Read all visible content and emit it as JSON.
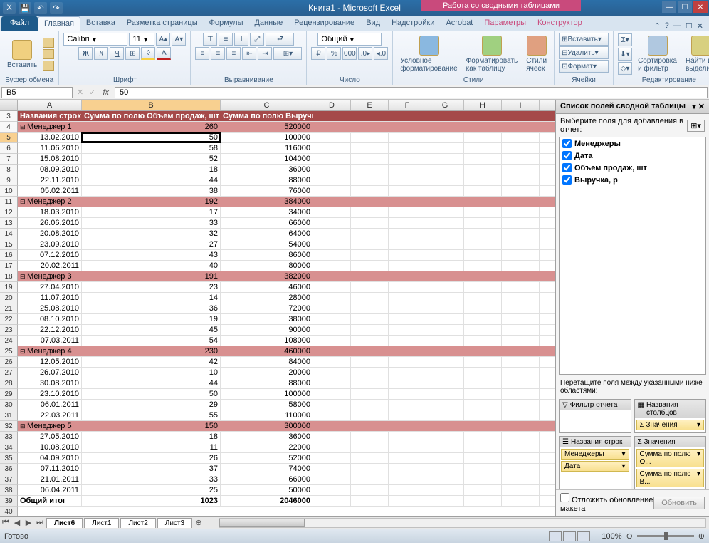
{
  "title": "Книга1 - Microsoft Excel",
  "contextTab": "Работа со сводными таблицами",
  "tabs": {
    "file": "Файл",
    "list": [
      "Главная",
      "Вставка",
      "Разметка страницы",
      "Формулы",
      "Данные",
      "Рецензирование",
      "Вид",
      "Надстройки",
      "Acrobat"
    ],
    "ctx": [
      "Параметры",
      "Конструктор"
    ],
    "active": "Главная"
  },
  "ribbon": {
    "clipboard": {
      "paste": "Вставить",
      "label": "Буфер обмена"
    },
    "font": {
      "name": "Calibri",
      "size": "11",
      "label": "Шрифт"
    },
    "align": {
      "label": "Выравнивание"
    },
    "number": {
      "format": "Общий",
      "label": "Число"
    },
    "styles": {
      "cond": "Условное форматирование",
      "table": "Форматировать как таблицу",
      "cell": "Стили ячеек",
      "label": "Стили"
    },
    "cells": {
      "insert": "Вставить",
      "delete": "Удалить",
      "format": "Формат",
      "label": "Ячейки"
    },
    "editing": {
      "sort": "Сортировка и фильтр",
      "find": "Найти и выделить",
      "label": "Редактирование"
    }
  },
  "namebox": "B5",
  "formula": "50",
  "cols": [
    "A",
    "B",
    "C",
    "D",
    "E",
    "F",
    "G",
    "H",
    "I"
  ],
  "colWidths": {
    "A": 90,
    "B": 195,
    "C": 130
  },
  "pivotHeader": [
    "Названия строк",
    "Сумма по полю Объем продаж, шт",
    "Сумма по полю Выручка, р"
  ],
  "rows": [
    {
      "n": 4,
      "t": "mgr",
      "c": [
        "Менеджер 1",
        "260",
        "520000"
      ]
    },
    {
      "n": 5,
      "t": "d",
      "c": [
        "13.02.2010",
        "50",
        "100000"
      ],
      "active": true
    },
    {
      "n": 6,
      "t": "d",
      "c": [
        "11.06.2010",
        "58",
        "116000"
      ]
    },
    {
      "n": 7,
      "t": "d",
      "c": [
        "15.08.2010",
        "52",
        "104000"
      ]
    },
    {
      "n": 8,
      "t": "d",
      "c": [
        "08.09.2010",
        "18",
        "36000"
      ]
    },
    {
      "n": 9,
      "t": "d",
      "c": [
        "22.11.2010",
        "44",
        "88000"
      ]
    },
    {
      "n": 10,
      "t": "d",
      "c": [
        "05.02.2011",
        "38",
        "76000"
      ]
    },
    {
      "n": 11,
      "t": "mgr",
      "c": [
        "Менеджер 2",
        "192",
        "384000"
      ]
    },
    {
      "n": 12,
      "t": "d",
      "c": [
        "18.03.2010",
        "17",
        "34000"
      ]
    },
    {
      "n": 13,
      "t": "d",
      "c": [
        "26.06.2010",
        "33",
        "66000"
      ]
    },
    {
      "n": 14,
      "t": "d",
      "c": [
        "20.08.2010",
        "32",
        "64000"
      ]
    },
    {
      "n": 15,
      "t": "d",
      "c": [
        "23.09.2010",
        "27",
        "54000"
      ]
    },
    {
      "n": 16,
      "t": "d",
      "c": [
        "07.12.2010",
        "43",
        "86000"
      ]
    },
    {
      "n": 17,
      "t": "d",
      "c": [
        "20.02.2011",
        "40",
        "80000"
      ]
    },
    {
      "n": 18,
      "t": "mgr",
      "c": [
        "Менеджер 3",
        "191",
        "382000"
      ]
    },
    {
      "n": 19,
      "t": "d",
      "c": [
        "27.04.2010",
        "23",
        "46000"
      ]
    },
    {
      "n": 20,
      "t": "d",
      "c": [
        "11.07.2010",
        "14",
        "28000"
      ]
    },
    {
      "n": 21,
      "t": "d",
      "c": [
        "25.08.2010",
        "36",
        "72000"
      ]
    },
    {
      "n": 22,
      "t": "d",
      "c": [
        "08.10.2010",
        "19",
        "38000"
      ]
    },
    {
      "n": 23,
      "t": "d",
      "c": [
        "22.12.2010",
        "45",
        "90000"
      ]
    },
    {
      "n": 24,
      "t": "d",
      "c": [
        "07.03.2011",
        "54",
        "108000"
      ]
    },
    {
      "n": 25,
      "t": "mgr",
      "c": [
        "Менеджер 4",
        "230",
        "460000"
      ]
    },
    {
      "n": 26,
      "t": "d",
      "c": [
        "12.05.2010",
        "42",
        "84000"
      ]
    },
    {
      "n": 27,
      "t": "d",
      "c": [
        "26.07.2010",
        "10",
        "20000"
      ]
    },
    {
      "n": 28,
      "t": "d",
      "c": [
        "30.08.2010",
        "44",
        "88000"
      ]
    },
    {
      "n": 29,
      "t": "d",
      "c": [
        "23.10.2010",
        "50",
        "100000"
      ]
    },
    {
      "n": 30,
      "t": "d",
      "c": [
        "06.01.2011",
        "29",
        "58000"
      ]
    },
    {
      "n": 31,
      "t": "d",
      "c": [
        "22.03.2011",
        "55",
        "110000"
      ]
    },
    {
      "n": 32,
      "t": "mgr",
      "c": [
        "Менеджер 5",
        "150",
        "300000"
      ]
    },
    {
      "n": 33,
      "t": "d",
      "c": [
        "27.05.2010",
        "18",
        "36000"
      ]
    },
    {
      "n": 34,
      "t": "d",
      "c": [
        "10.08.2010",
        "11",
        "22000"
      ]
    },
    {
      "n": 35,
      "t": "d",
      "c": [
        "04.09.2010",
        "26",
        "52000"
      ]
    },
    {
      "n": 36,
      "t": "d",
      "c": [
        "07.11.2010",
        "37",
        "74000"
      ]
    },
    {
      "n": 37,
      "t": "d",
      "c": [
        "21.01.2011",
        "33",
        "66000"
      ]
    },
    {
      "n": 38,
      "t": "d",
      "c": [
        "06.04.2011",
        "25",
        "50000"
      ]
    },
    {
      "n": 39,
      "t": "total",
      "c": [
        "Общий итог",
        "1023",
        "2046000"
      ]
    }
  ],
  "pivotPane": {
    "title": "Список полей сводной таблицы",
    "choose": "Выберите поля для добавления в отчет:",
    "fields": [
      {
        "name": "Менеджеры",
        "checked": true
      },
      {
        "name": "Дата",
        "checked": true
      },
      {
        "name": "Объем продаж, шт",
        "checked": true
      },
      {
        "name": "Выручка, р",
        "checked": true
      }
    ],
    "dragMsg": "Перетащите поля между указанными ниже областями:",
    "areas": {
      "filter": {
        "label": "Фильтр отчета",
        "items": []
      },
      "cols": {
        "label": "Названия столбцов",
        "items": [
          "Σ Значения"
        ]
      },
      "rows": {
        "label": "Названия строк",
        "items": [
          "Менеджеры",
          "Дата"
        ]
      },
      "vals": {
        "label": "Σ  Значения",
        "items": [
          "Сумма по полю О...",
          "Сумма по полю В..."
        ]
      }
    },
    "defer": "Отложить обновление макета",
    "update": "Обновить"
  },
  "sheets": {
    "list": [
      "Лист6",
      "Лист1",
      "Лист2",
      "Лист3"
    ],
    "active": "Лист6"
  },
  "status": "Готово",
  "zoom": "100%"
}
